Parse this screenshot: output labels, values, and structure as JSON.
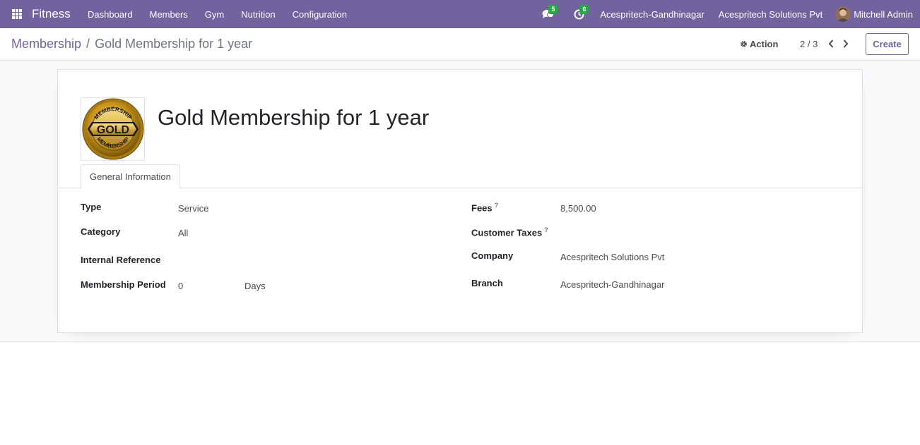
{
  "navbar": {
    "app_name": "Fitness",
    "menu": [
      "Dashboard",
      "Members",
      "Gym",
      "Nutrition",
      "Configuration"
    ],
    "messages_badge": "5",
    "activities_badge": "6",
    "branch": "Acespritech-Gandhinagar",
    "company": "Acespritech Solutions Pvt",
    "user_name": "Mitchell Admin"
  },
  "control_panel": {
    "breadcrumb_parent": "Membership",
    "breadcrumb_separator": "/",
    "breadcrumb_current": "Gold Membership for 1 year",
    "action_label": "Action",
    "pager": "2 / 3",
    "create_label": "Create"
  },
  "record": {
    "image_text": "GOLD",
    "image_ring_text": "MEMBERSHIP",
    "title": "Gold Membership for 1 year",
    "tab_label": "General Information",
    "fields_left": {
      "type_label": "Type",
      "type_value": "Service",
      "category_label": "Category",
      "category_value": "All",
      "internal_ref_label": "Internal Reference",
      "internal_ref_value": "",
      "period_label": "Membership Period",
      "period_value": "0",
      "period_unit": "Days"
    },
    "fields_right": {
      "fees_label": "Fees",
      "fees_value": "8,500.00",
      "taxes_label": "Customer Taxes",
      "taxes_value": "",
      "company_label": "Company",
      "company_value": "Acespritech Solutions Pvt",
      "branch_label": "Branch",
      "branch_value": "Acespritech-Gandhinagar"
    },
    "help_marker": "?"
  },
  "colors": {
    "brand": "#71639e",
    "badge": "#28a745",
    "gold": "#c9a227"
  },
  "icons": [
    "apps-icon",
    "chat-icon",
    "clock-icon",
    "gear-icon",
    "chevron-left-icon",
    "chevron-right-icon"
  ]
}
